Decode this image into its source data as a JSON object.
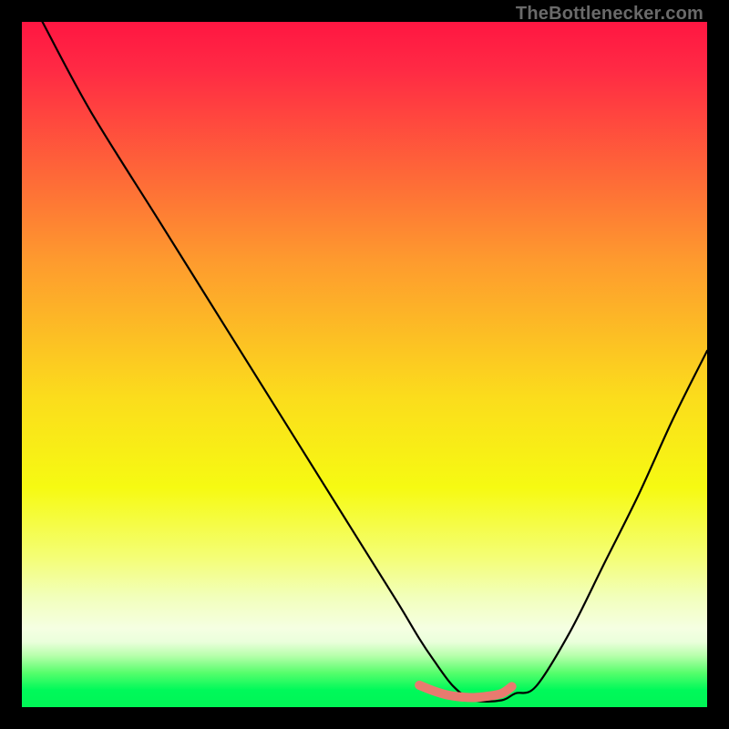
{
  "attribution": "TheBottlenecker.com",
  "colors": {
    "black": "#000000",
    "text": "#6a6a6a",
    "curve": "#000000",
    "marker": "#e97a6f",
    "gradient_stops": [
      {
        "offset": 0.0,
        "color": "#ff1642"
      },
      {
        "offset": 0.07,
        "color": "#ff2a44"
      },
      {
        "offset": 0.35,
        "color": "#fe9b2e"
      },
      {
        "offset": 0.55,
        "color": "#fbdd1c"
      },
      {
        "offset": 0.68,
        "color": "#f6fa12"
      },
      {
        "offset": 0.78,
        "color": "#f4fe74"
      },
      {
        "offset": 0.84,
        "color": "#f2ffbc"
      },
      {
        "offset": 0.885,
        "color": "#f5ffe2"
      },
      {
        "offset": 0.905,
        "color": "#eaffdb"
      },
      {
        "offset": 0.925,
        "color": "#b7ffab"
      },
      {
        "offset": 0.95,
        "color": "#56fe6c"
      },
      {
        "offset": 0.975,
        "color": "#00f95a"
      },
      {
        "offset": 1.0,
        "color": "#00f556"
      }
    ]
  },
  "chart_data": {
    "type": "line",
    "title": "",
    "xlabel": "",
    "ylabel": "",
    "xlim": [
      0,
      100
    ],
    "ylim": [
      0,
      100
    ],
    "grid": false,
    "legend": false,
    "series": [
      {
        "name": "bottleneck-curve",
        "x": [
          3,
          10,
          20,
          30,
          40,
          50,
          55,
          58,
          60,
          63,
          66,
          70,
          72,
          75,
          80,
          85,
          90,
          95,
          100
        ],
        "y": [
          100,
          87,
          71,
          55,
          39,
          23,
          15,
          10,
          7,
          3,
          1,
          1,
          2,
          3,
          11,
          21,
          31,
          42,
          52
        ]
      }
    ],
    "marker": {
      "name": "optimal-range",
      "x": [
        58,
        60,
        62,
        64,
        66,
        68,
        70,
        71.5
      ],
      "y": [
        3.2,
        2.4,
        1.8,
        1.5,
        1.4,
        1.6,
        2.0,
        3.0
      ]
    }
  }
}
